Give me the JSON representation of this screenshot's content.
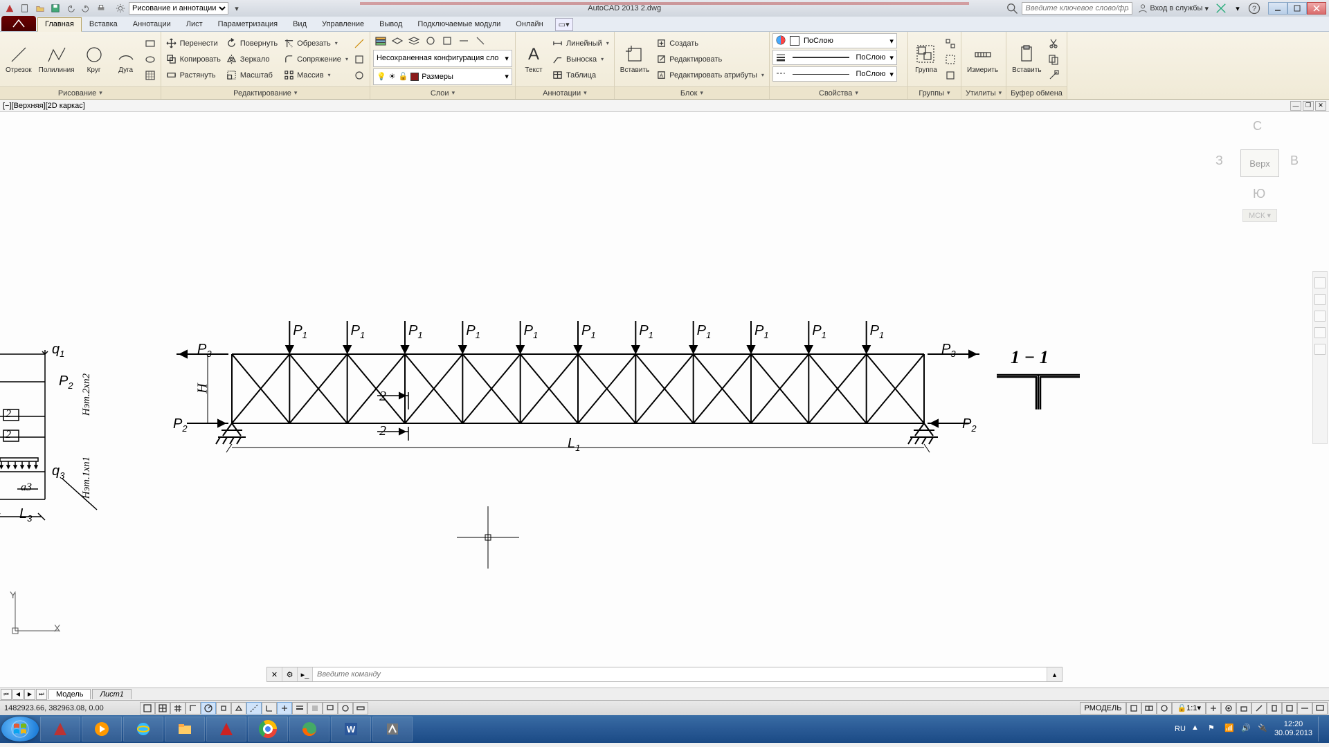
{
  "title": "AutoCAD 2013   2.dwg",
  "workspace": "Рисование и аннотации",
  "search_placeholder": "Введите ключевое слово/фразу",
  "login": "Вход в службы",
  "tabs": [
    "Главная",
    "Вставка",
    "Аннотации",
    "Лист",
    "Параметризация",
    "Вид",
    "Управление",
    "Вывод",
    "Подключаемые модули",
    "Онлайн"
  ],
  "active_tab": 0,
  "panels": {
    "draw": {
      "title": "Рисование",
      "tools": [
        "Отрезок",
        "Полилиния",
        "Круг",
        "Дуга"
      ]
    },
    "modify": {
      "title": "Редактирование",
      "rows": [
        [
          "Перенести",
          "Повернуть",
          "Обрезать"
        ],
        [
          "Копировать",
          "Зеркало",
          "Сопряжение"
        ],
        [
          "Растянуть",
          "Масштаб",
          "Массив"
        ]
      ]
    },
    "layers": {
      "title": "Слои",
      "unsaved": "Несохраненная конфигурация сло",
      "dim": "Размеры"
    },
    "annotation": {
      "title": "Аннотации",
      "text": "Текст",
      "rows": [
        "Линейный",
        "Выноска",
        "Таблица"
      ]
    },
    "block": {
      "title": "Блок",
      "insert": "Вставить",
      "rows": [
        "Создать",
        "Редактировать",
        "Редактировать атрибуты"
      ]
    },
    "properties": {
      "title": "Свойства",
      "bylayer": "ПоСлою"
    },
    "groups": {
      "title": "Группы",
      "group": "Группа"
    },
    "utilities": {
      "title": "Утилиты",
      "measure": "Измерить"
    },
    "clipboard": {
      "title": "Буфер обмена",
      "paste": "Вставить"
    }
  },
  "doc_header": "[−][Верхняя][2D каркас]",
  "viewcube": {
    "n": "С",
    "s": "Ю",
    "e": "В",
    "w": "З",
    "top": "Верх",
    "wcs": "МСК"
  },
  "cmdline_placeholder": "Введите команду",
  "model_tabs": [
    "Модель",
    "Лист1"
  ],
  "coords": "1482923.66, 382963.08, 0.00",
  "rmodel": "РМОДЕЛЬ",
  "scale": "1:1",
  "lang": "RU",
  "clock": {
    "time": "12:20",
    "date": "30.09.2013"
  },
  "drawing": {
    "loads": "P₁",
    "p1": "P",
    "sub1": "1",
    "p2": "P",
    "sub2": "2",
    "p3": "P",
    "sub3": "3",
    "q1": "q",
    "qsub1": "1",
    "q3": "q",
    "qsub3": "3",
    "L1": "L",
    "Lsub1": "1",
    "L3": "L",
    "Lsub3": "3",
    "H": "H",
    "Het1": "Нэт.1xn1",
    "Het2": "Нэт.2xn2",
    "a3": "a3",
    "two": "2",
    "section": "1 − 1"
  }
}
